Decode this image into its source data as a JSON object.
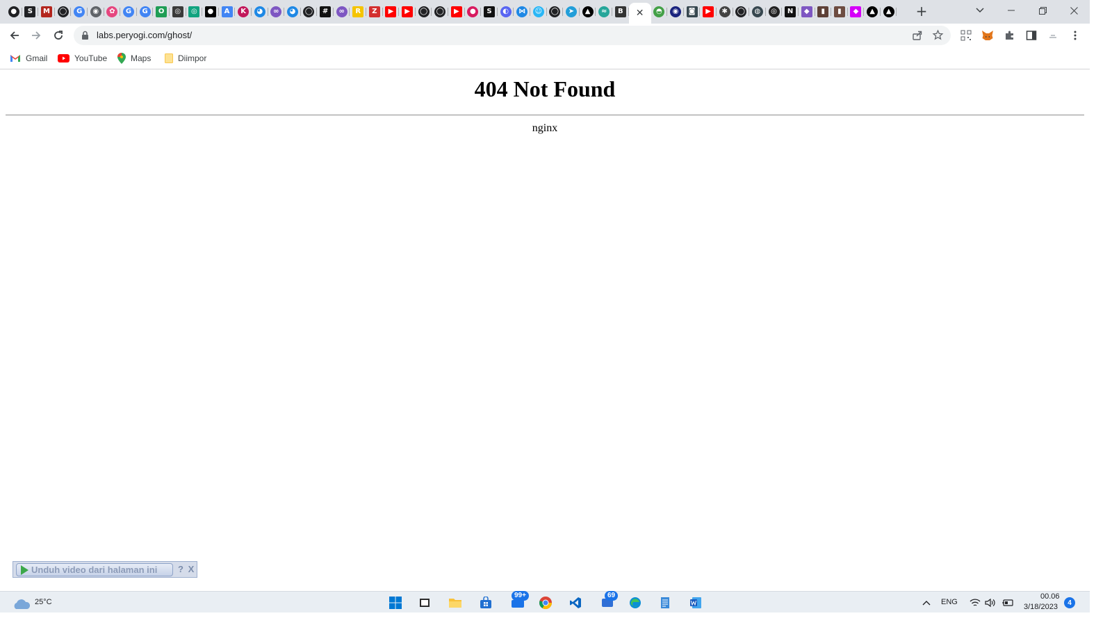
{
  "browser": {
    "url": "labs.peryogi.com/ghost/",
    "tabs": [
      {
        "icon": "privacy-badger-icon",
        "glyph": "●",
        "color": "#202124"
      },
      {
        "icon": "scribd-s-icon",
        "glyph": "S",
        "color": "#202124",
        "square": true
      },
      {
        "icon": "mb-logo-icon",
        "glyph": "M",
        "color": "#b3261e",
        "square": true
      },
      {
        "icon": "github-icon",
        "glyph": "◯",
        "color": "#202124"
      },
      {
        "icon": "google-icon",
        "glyph": "G",
        "color": "#4285f4"
      },
      {
        "icon": "globe-icon",
        "glyph": "◉",
        "color": "#5f6368"
      },
      {
        "icon": "flower-icon",
        "glyph": "✿",
        "color": "#e6467f"
      },
      {
        "icon": "google-icon",
        "glyph": "G",
        "color": "#4285f4"
      },
      {
        "icon": "google-icon",
        "glyph": "G",
        "color": "#4285f4"
      },
      {
        "icon": "green-ok-icon",
        "glyph": "O",
        "color": "#1f9d55",
        "square": true
      },
      {
        "icon": "dark-square-icon",
        "glyph": "◎",
        "color": "#3a3a3a",
        "square": true
      },
      {
        "icon": "openai-icon",
        "glyph": "◎",
        "color": "#10a37f",
        "square": true
      },
      {
        "icon": "medium-icon",
        "glyph": "●",
        "color": "#000000",
        "square": true
      },
      {
        "icon": "translate-icon",
        "glyph": "A",
        "color": "#4285f4",
        "square": true
      },
      {
        "icon": "k-logo-icon",
        "glyph": "K",
        "color": "#c2185b"
      },
      {
        "icon": "blue-logo-icon",
        "glyph": "◕",
        "color": "#1e88e5"
      },
      {
        "icon": "infinity-icon",
        "glyph": "∞",
        "color": "#7e57c2"
      },
      {
        "icon": "blue-logo-icon",
        "glyph": "◕",
        "color": "#1e88e5"
      },
      {
        "icon": "github-icon",
        "glyph": "◯",
        "color": "#202124"
      },
      {
        "icon": "hashnode-icon",
        "glyph": "#",
        "color": "#111111",
        "square": true
      },
      {
        "icon": "infinity-icon",
        "glyph": "∞",
        "color": "#7e57c2"
      },
      {
        "icon": "yellow-r-icon",
        "glyph": "R",
        "color": "#f5c400",
        "square": true
      },
      {
        "icon": "zotero-z-icon",
        "glyph": "Z",
        "color": "#d32f2f",
        "square": true
      },
      {
        "icon": "youtube-icon",
        "glyph": "▶",
        "color": "#ff0000",
        "square": true
      },
      {
        "icon": "youtube-icon",
        "glyph": "▶",
        "color": "#ff0000",
        "square": true
      },
      {
        "icon": "github-icon",
        "glyph": "◯",
        "color": "#202124"
      },
      {
        "icon": "github-icon",
        "glyph": "◯",
        "color": "#202124"
      },
      {
        "icon": "youtube-icon",
        "glyph": "▶",
        "color": "#ff0000",
        "square": true
      },
      {
        "icon": "red-badge-icon",
        "glyph": "●",
        "color": "#d81b60"
      },
      {
        "icon": "skype-icon",
        "glyph": "S",
        "color": "#111111",
        "square": true
      },
      {
        "icon": "discord-icon",
        "glyph": "◐",
        "color": "#5865f2"
      },
      {
        "icon": "bluesky-icon",
        "glyph": "⋈",
        "color": "#1e88e5"
      },
      {
        "icon": "cyan-face-icon",
        "glyph": "☺",
        "color": "#29b6f6"
      },
      {
        "icon": "github-icon",
        "glyph": "◯",
        "color": "#202124"
      },
      {
        "icon": "telegram-icon",
        "glyph": "➤",
        "color": "#229ed9"
      },
      {
        "icon": "triangle-logo-icon",
        "glyph": "▲",
        "color": "#000000"
      },
      {
        "icon": "wave-icon",
        "glyph": "≈",
        "color": "#26a69a"
      },
      {
        "icon": "bt-logo-icon",
        "glyph": "B",
        "color": "#333333",
        "square": true
      },
      {
        "icon": "active-tab",
        "active": true
      },
      {
        "icon": "android-icon",
        "glyph": "◓",
        "color": "#43a047"
      },
      {
        "icon": "circle-logo-icon",
        "glyph": "◉",
        "color": "#1a237e"
      },
      {
        "icon": "dark-square-icon",
        "glyph": "◙",
        "color": "#37474f",
        "square": true
      },
      {
        "icon": "youtube-icon",
        "glyph": "▶",
        "color": "#ff0000",
        "square": true
      },
      {
        "icon": "mascot-icon",
        "glyph": "✱",
        "color": "#424242"
      },
      {
        "icon": "github-icon",
        "glyph": "◯",
        "color": "#202124"
      },
      {
        "icon": "dark-circle-icon",
        "glyph": "◍",
        "color": "#37474f"
      },
      {
        "icon": "openai-icon",
        "glyph": "◎",
        "color": "#212121"
      },
      {
        "icon": "notion-icon",
        "glyph": "N",
        "color": "#111111",
        "square": true
      },
      {
        "icon": "purple-logo-icon",
        "glyph": "◆",
        "color": "#7e57c2",
        "square": true
      },
      {
        "icon": "brown-square-icon",
        "glyph": "▮",
        "color": "#5d4037",
        "square": true
      },
      {
        "icon": "brown-square-icon",
        "glyph": "▮",
        "color": "#6d4c41",
        "square": true
      },
      {
        "icon": "pink-logo-icon",
        "glyph": "◆",
        "color": "#d500f9",
        "square": true
      },
      {
        "icon": "triangle-logo-icon",
        "glyph": "▲",
        "color": "#000000"
      },
      {
        "icon": "triangle-logo-icon",
        "glyph": "▲",
        "color": "#000000"
      }
    ]
  },
  "bookmarks": [
    {
      "label": "Gmail",
      "icon": "gmail-icon"
    },
    {
      "label": "YouTube",
      "icon": "youtube-icon"
    },
    {
      "label": "Maps",
      "icon": "maps-icon"
    },
    {
      "label": "Diimpor",
      "icon": "folder-icon"
    }
  ],
  "page": {
    "heading": "404 Not Found",
    "server": "nginx"
  },
  "download_bar": {
    "label": "Unduh video dari halaman ini",
    "help": "?",
    "close": "X"
  },
  "taskbar": {
    "weather": "25°C",
    "mail_badge": "99+",
    "chat_badge": "69",
    "language": "ENG",
    "time": "00.06",
    "date": "3/18/2023",
    "notifications": "4"
  }
}
